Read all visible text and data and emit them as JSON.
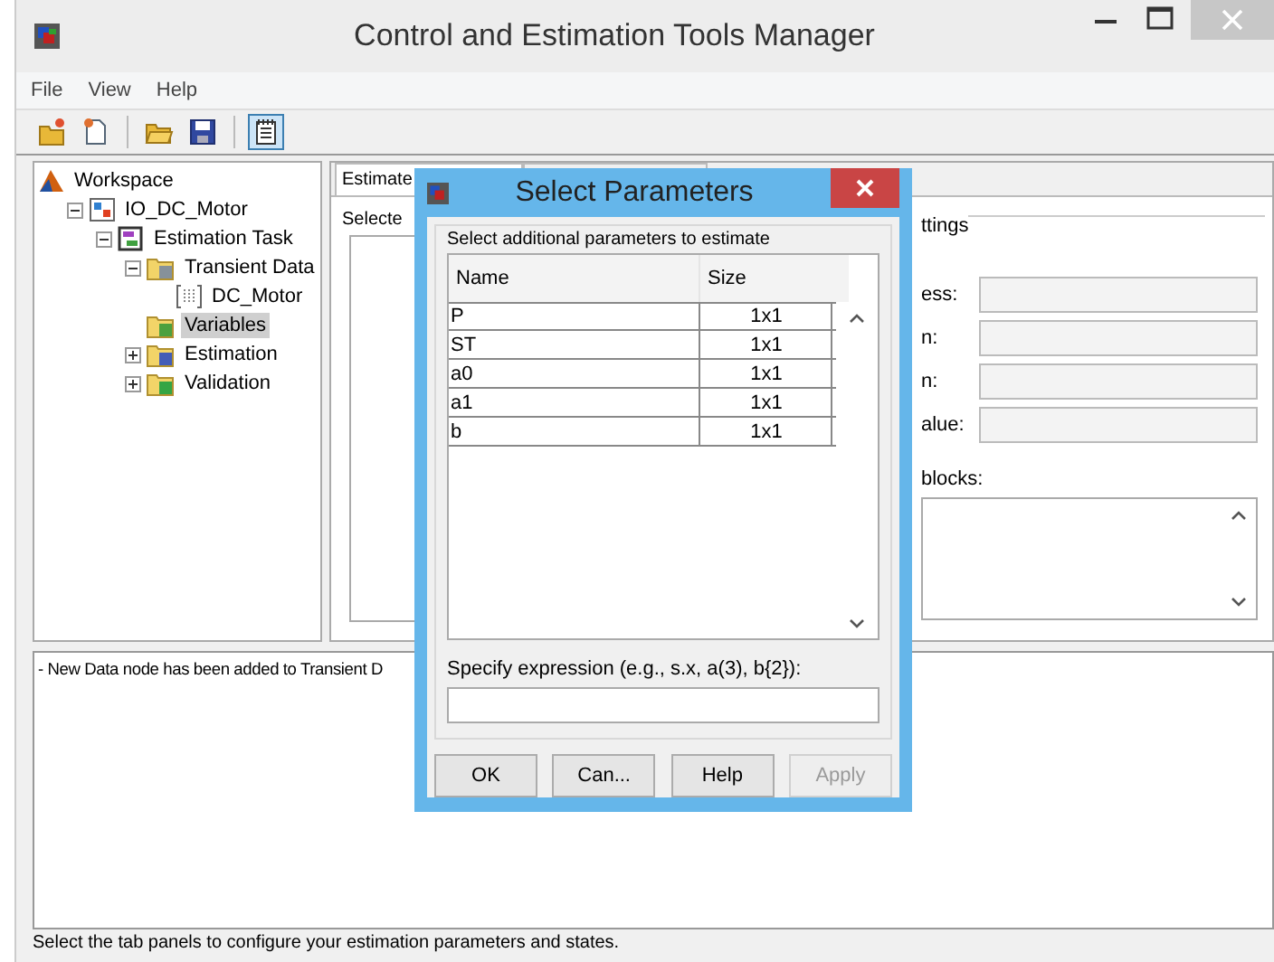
{
  "window": {
    "title": "Control and Estimation Tools Manager"
  },
  "menu": [
    "File",
    "View",
    "Help"
  ],
  "toolbar": [
    {
      "kind": "open-project",
      "selected": false
    },
    {
      "kind": "new",
      "selected": false
    },
    {
      "kind": "open",
      "selected": false
    },
    {
      "kind": "save",
      "selected": false
    },
    {
      "kind": "notes",
      "selected": true
    }
  ],
  "tree": [
    {
      "label": "Workspace",
      "kind": "workspace",
      "selected": false,
      "children": [
        {
          "label": "IO_DC_Motor",
          "kind": "model",
          "expanded": true,
          "selected": false,
          "children": [
            {
              "label": "Estimation Task",
              "kind": "task",
              "expanded": true,
              "selected": false,
              "children": [
                {
                  "label": "Transient Data",
                  "kind": "data-folder",
                  "expanded": true,
                  "selected": false,
                  "children": [
                    {
                      "label": "DC_Motor",
                      "kind": "data",
                      "selected": false
                    }
                  ]
                },
                {
                  "label": "Variables",
                  "kind": "variables-folder",
                  "selected": true
                },
                {
                  "label": "Estimation",
                  "kind": "estimation-folder",
                  "expanded": false,
                  "selected": false
                },
                {
                  "label": "Validation",
                  "kind": "validation-folder",
                  "expanded": false,
                  "selected": false
                }
              ]
            }
          ]
        }
      ]
    }
  ],
  "right_panel": {
    "tabs": [
      {
        "label": "Estimate",
        "selected": true
      }
    ],
    "left_group": {
      "label": "Selecte"
    },
    "right_group": {
      "label": "ttings",
      "fields": [
        "ess:",
        "n:",
        "n:",
        "alue:"
      ],
      "list_label": "blocks:"
    }
  },
  "log": "- New Data node has been added to Transient D",
  "status_bar": "Select the tab panels to configure your estimation parameters and states.",
  "dialog": {
    "title": "Select Parameters",
    "group_label": "Select additional parameters to estimate",
    "columns": [
      "Name",
      "Size"
    ],
    "rows": [
      [
        "P",
        "1x1"
      ],
      [
        "ST",
        "1x1"
      ],
      [
        "a0",
        "1x1"
      ],
      [
        "a1",
        "1x1"
      ],
      [
        "b",
        "1x1"
      ]
    ],
    "expression_label": "Specify expression (e.g., s.x, a(3), b{2}):",
    "buttons": [
      {
        "label": "OK",
        "disabled": false
      },
      {
        "label": "Can...",
        "disabled": false
      },
      {
        "label": "Help",
        "disabled": false
      },
      {
        "label": "Apply",
        "disabled": true
      }
    ]
  }
}
